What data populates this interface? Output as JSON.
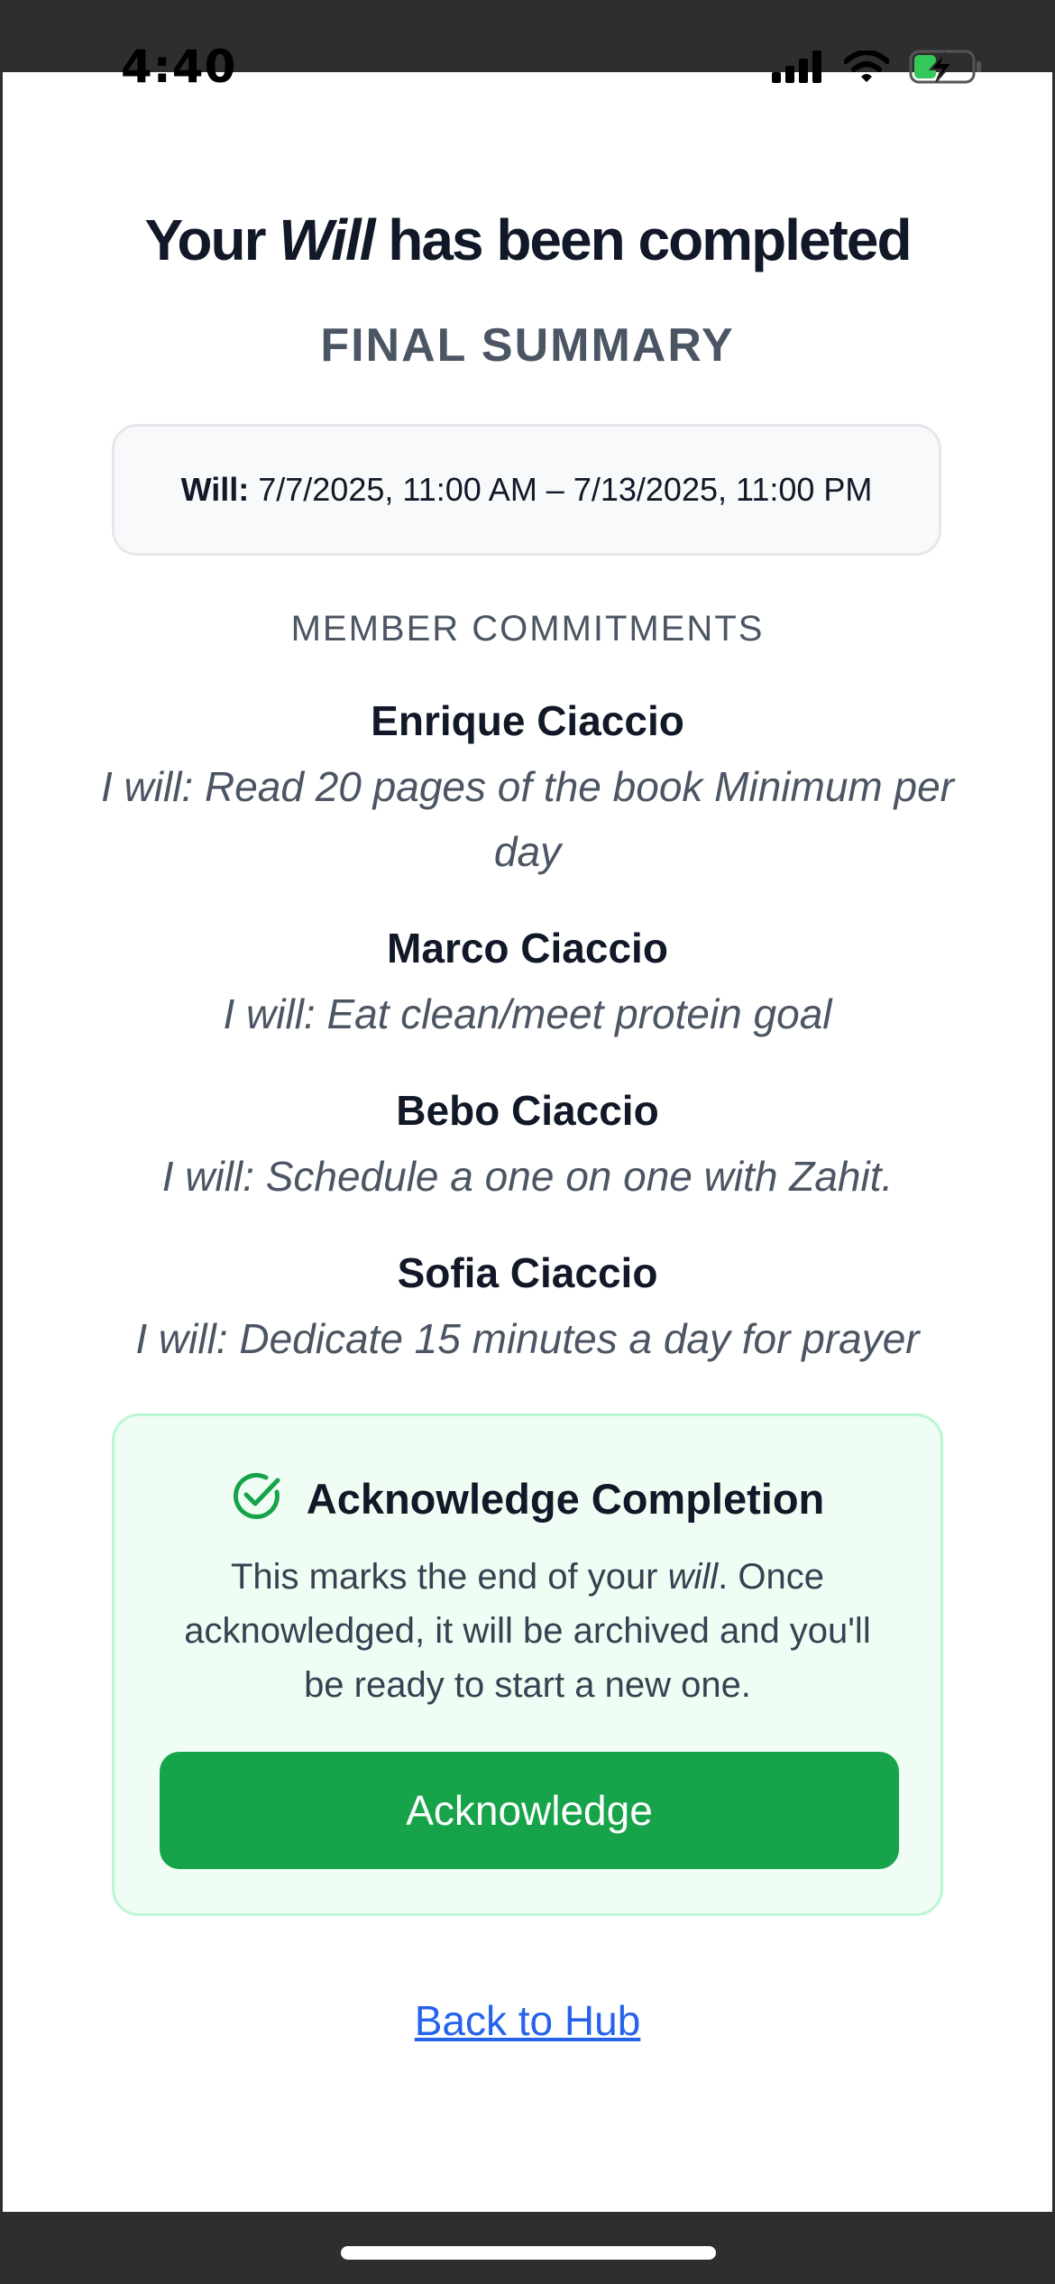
{
  "status_bar": {
    "time": "4:40",
    "icons": [
      "cellular-signal-icon",
      "wifi-icon",
      "battery-charging-icon"
    ]
  },
  "page": {
    "title_prefix": "Your ",
    "title_emphasis": "Will",
    "title_suffix": " has been completed",
    "section_label": "FINAL SUMMARY"
  },
  "will_period": {
    "label": "Will:",
    "value": "7/7/2025, 11:00 AM – 7/13/2025, 11:00 PM"
  },
  "members": {
    "heading": "MEMBER COMMITMENTS",
    "items": [
      {
        "name": "Enrique Ciaccio",
        "commitment": "I will: Read 20 pages of the book Minimum per day"
      },
      {
        "name": "Marco Ciaccio",
        "commitment": "I will: Eat clean/meet protein goal"
      },
      {
        "name": "Bebo Ciaccio",
        "commitment": "I will: Schedule a one on one with Zahit."
      },
      {
        "name": "Sofia Ciaccio",
        "commitment": "I will: Dedicate 15 minutes a day for prayer"
      }
    ]
  },
  "acknowledge": {
    "icon": "check-circle-icon",
    "title": "Acknowledge Completion",
    "body_prefix": "This marks the end of your ",
    "body_emphasis": "will",
    "body_suffix": ". Once acknowledged, it will be archived and you'll be ready to start a new one.",
    "button_label": "Acknowledge"
  },
  "nav": {
    "back_label": "Back to Hub"
  },
  "colors": {
    "accent_green": "#16a34a",
    "card_green_bg": "#f0fdf4",
    "link_blue": "#2563eb",
    "heading_dark": "#111827",
    "muted_text": "#4b5563"
  }
}
